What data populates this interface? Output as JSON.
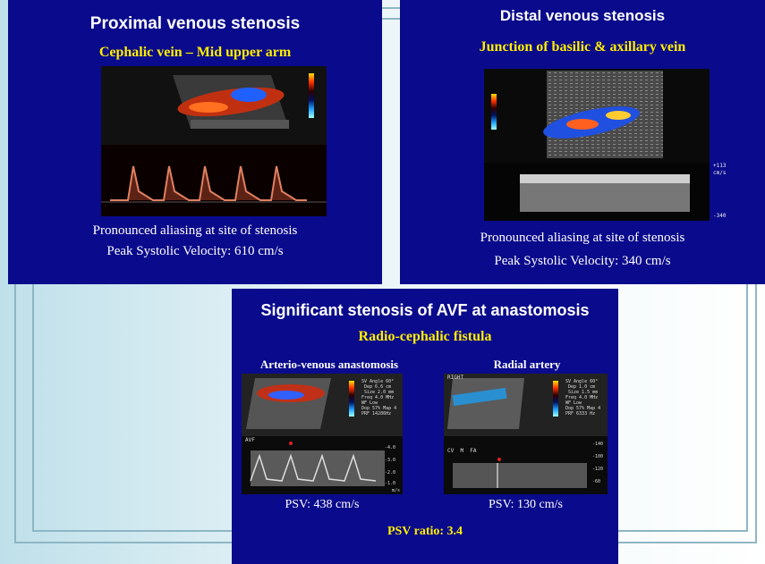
{
  "slides": {
    "proximal": {
      "title": "Proximal venous stenosis",
      "subtitle": "Cephalic vein – Mid upper arm",
      "caption_1": "Pronounced aliasing at site of stenosis",
      "caption_2": "Peak Systolic Velocity: 610 cm/s"
    },
    "distal": {
      "title": "Distal venous stenosis",
      "subtitle": "Junction of basilic & axillary vein",
      "caption_1": "Pronounced aliasing at site of stenosis",
      "caption_2": "Peak Systolic Velocity: 340 cm/s",
      "scale_top": "+113",
      "scale_unit": "cm/s",
      "scale_bottom": "-340"
    },
    "avf": {
      "title": "Significant stenosis of AVF at anastomosis",
      "subtitle": "Radio-cephalic fistula",
      "left_label": "Arterio-venous anastomosis",
      "right_label": "Radial artery",
      "left_psv": "PSV: 438 cm/s",
      "right_psv": "PSV: 130 cm/s",
      "ratio": "PSV ratio: 3.4",
      "left_mode": "AVF",
      "right_mode": "CV  M  FA",
      "left_ticks": [
        "-4.0",
        "-3.0",
        "-2.0",
        "-1.0"
      ],
      "right_ticks": [
        "-140",
        "-100",
        "-120",
        "-60"
      ],
      "left_unit": "m/s",
      "left_settings": "SV Angle 60°\n Dep 6.6 cm\n Size 2.0 mm\nFreq 4.0 MHz\nWF Low\nDop 57% Map 4\nPRF 14286Hz",
      "right_settings": "SV Angle 60°\n Dep 1.0 cm\n Size 1.5 mm\nFreq 4.0 MHz\nWF Low\nDop 57% Map 4\nPRF 6333 Hz",
      "right_probe_label": "RIGHT"
    }
  },
  "colors": {
    "slide_bg": "#0a0a8c",
    "title": "#ffffff",
    "subtitle": "#ffee00",
    "frame": "#8fb6c4"
  }
}
